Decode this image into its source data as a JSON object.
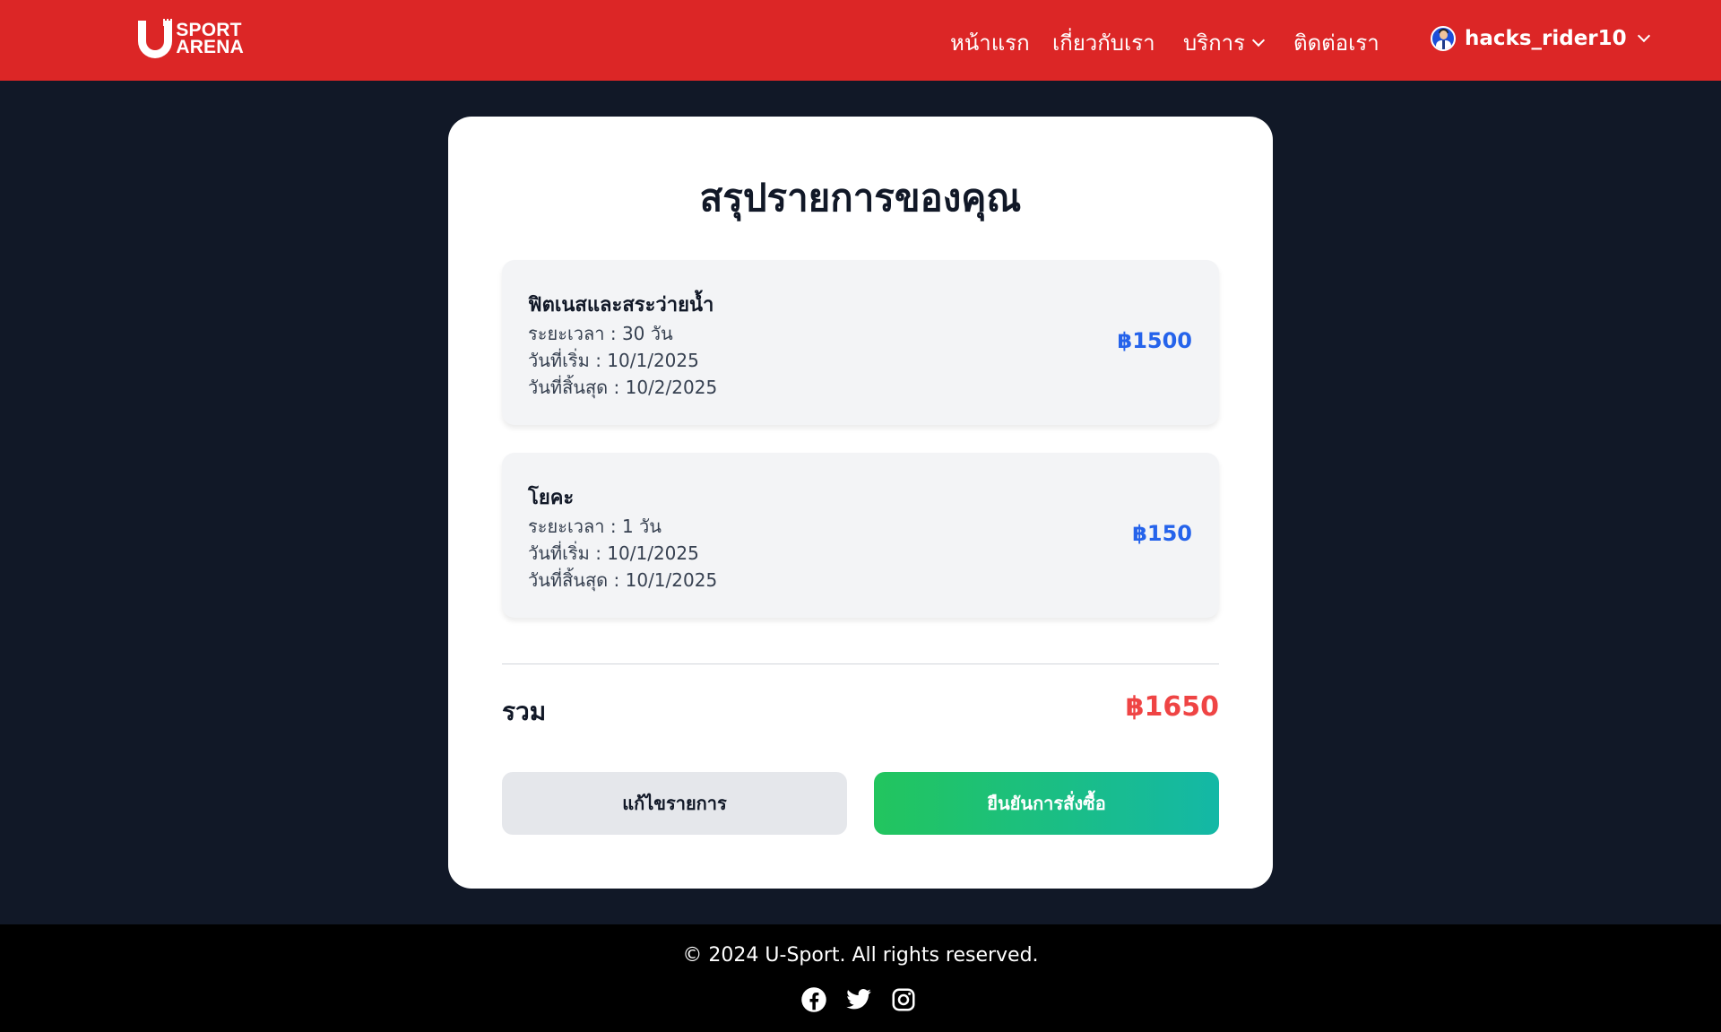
{
  "header": {
    "logo": {
      "line1": "SPORT",
      "line2": "ARENA",
      "letter": "U"
    },
    "nav": [
      {
        "label": "หน้าแรก"
      },
      {
        "label": "เกี่ยวกับเรา"
      },
      {
        "label": "บริการ"
      },
      {
        "label": "ติดต่อเรา"
      }
    ],
    "user": {
      "name": "hacks_rider10"
    }
  },
  "summary": {
    "title": "สรุปรายการของคุณ",
    "items": [
      {
        "name": "ฟิตเนสและสระว่ายน้ำ",
        "duration": "ระยะเวลา : 30 วัน",
        "start": "วันที่เริ่ม : 10/1/2025",
        "end": "วันที่สิ้นสุด : 10/2/2025",
        "price": "฿1500"
      },
      {
        "name": "โยคะ",
        "duration": "ระยะเวลา : 1 วัน",
        "start": "วันที่เริ่ม : 10/1/2025",
        "end": "วันที่สิ้นสุด : 10/1/2025",
        "price": "฿150"
      }
    ],
    "total_label": "รวม",
    "total_value": "฿1650",
    "edit_label": "แก้ไขรายการ",
    "confirm_label": "ยืนยันการสั่งซื้อ"
  },
  "footer": {
    "copyright": "© 2024 U-Sport. All rights reserved.",
    "socials": [
      "facebook-icon",
      "twitter-icon",
      "instagram-icon"
    ]
  },
  "colors": {
    "header_bg": "#dc2626",
    "page_bg": "#111827",
    "price": "#2563eb",
    "total": "#ef4444",
    "confirm_from": "#22c55e",
    "confirm_to": "#14b8a6"
  }
}
